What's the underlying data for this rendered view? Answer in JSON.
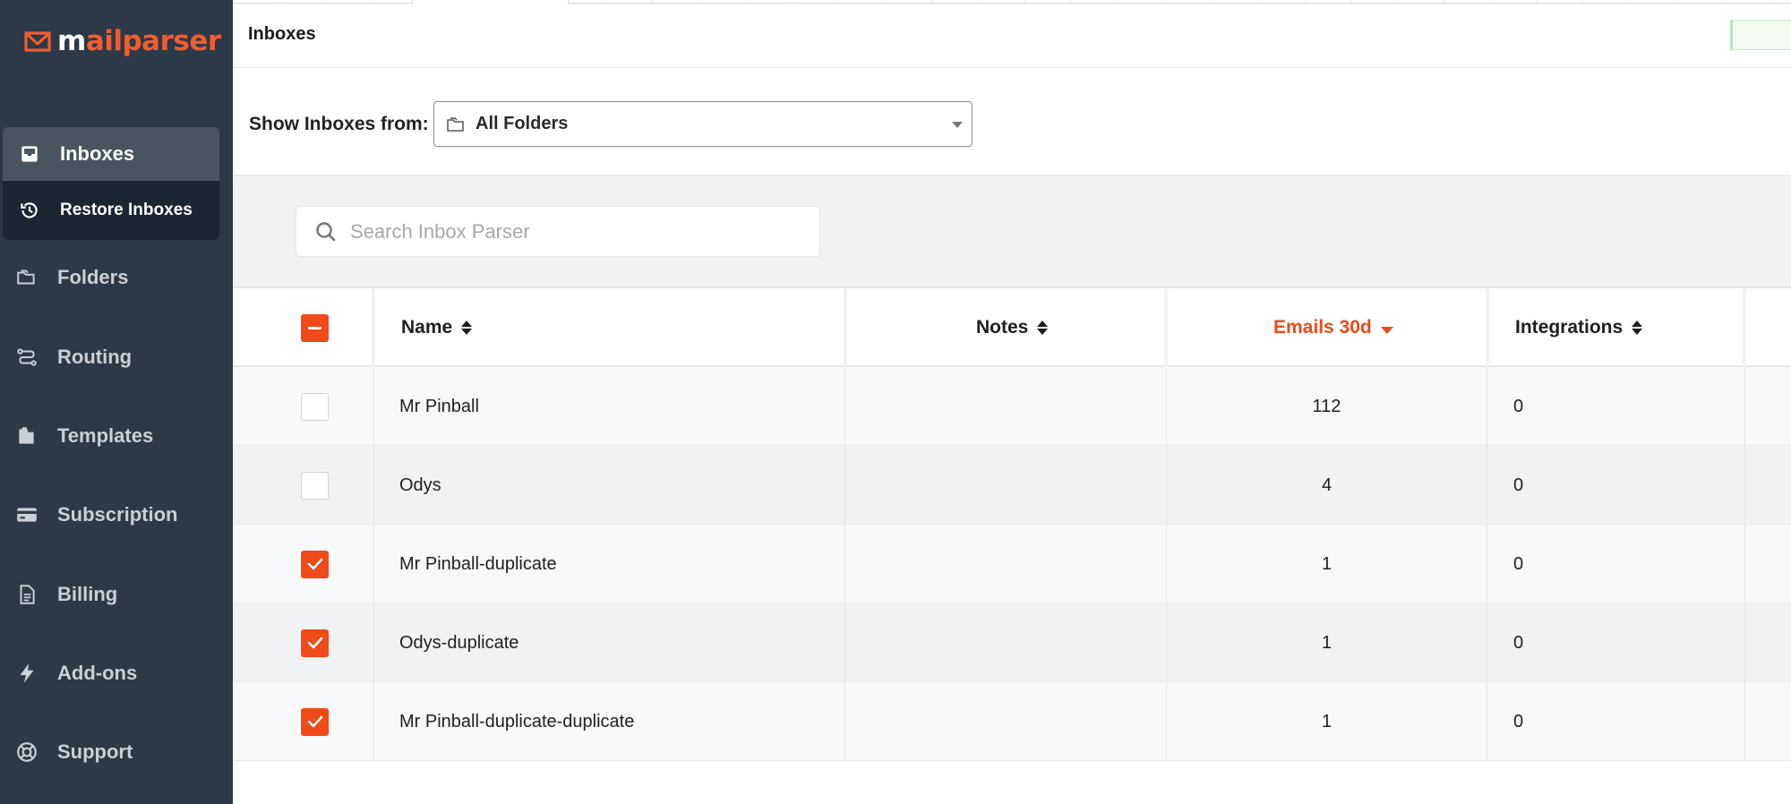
{
  "brand": {
    "logo_m": "m",
    "logo_rest": "ailparser",
    "accent": "#f04a18",
    "sidebar_bg": "#2b3a46"
  },
  "sidebar": {
    "active": {
      "label": "Inboxes",
      "icon": "inbox-icon"
    },
    "sub": {
      "label": "Restore Inboxes",
      "icon": "history-icon"
    },
    "items": [
      {
        "label": "Folders",
        "icon": "folder-icon"
      },
      {
        "label": "Routing",
        "icon": "routing-icon"
      },
      {
        "label": "Templates",
        "icon": "templates-icon"
      },
      {
        "label": "Subscription",
        "icon": "credit-card-icon"
      },
      {
        "label": "Billing",
        "icon": "document-icon"
      },
      {
        "label": "Add-ons",
        "icon": "bolt-icon"
      },
      {
        "label": "Support",
        "icon": "lifebuoy-icon"
      }
    ]
  },
  "header": {
    "title": "Inboxes"
  },
  "filter": {
    "label": "Show Inboxes from:",
    "selected": "All Folders"
  },
  "search": {
    "placeholder": "Search Inbox Parser",
    "value": ""
  },
  "table": {
    "columns": {
      "name": "Name",
      "notes": "Notes",
      "emails": "Emails 30d",
      "integrations": "Integrations"
    },
    "rows": [
      {
        "checked": false,
        "name": "Mr Pinball",
        "notes": "",
        "emails": "112",
        "integrations": "0"
      },
      {
        "checked": false,
        "name": "Odys",
        "notes": "",
        "emails": "4",
        "integrations": "0"
      },
      {
        "checked": true,
        "name": "Mr Pinball-duplicate",
        "notes": "",
        "emails": "1",
        "integrations": "0"
      },
      {
        "checked": true,
        "name": "Odys-duplicate",
        "notes": "",
        "emails": "1",
        "integrations": "0"
      },
      {
        "checked": true,
        "name": "Mr Pinball-duplicate-duplicate",
        "notes": "",
        "emails": "1",
        "integrations": "0"
      }
    ]
  }
}
